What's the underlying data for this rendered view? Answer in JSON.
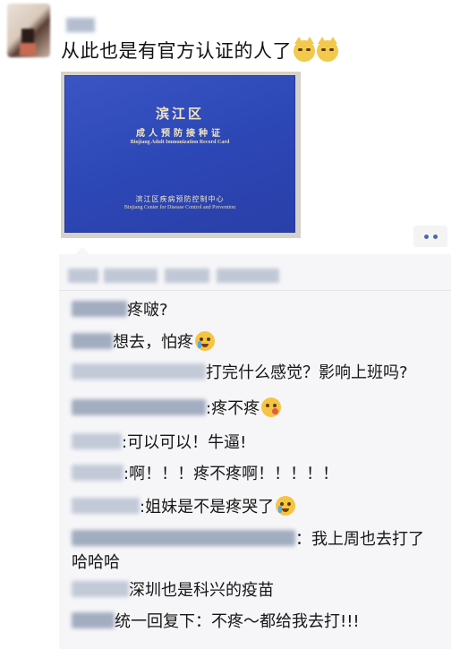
{
  "post": {
    "text": "从此也是有官方认证的人了"
  },
  "photo": {
    "title": "滨江区",
    "subtitle": "成人预防接种证",
    "subtitle_en": "Binjiang Adult Immunization Record Card",
    "issuer": "滨江区疾病预防控制中心",
    "issuer_en": "Binjiang Center for Disease Control and Prevention"
  },
  "comments": [
    {
      "text": "疼啵?",
      "emoji": ""
    },
    {
      "text": "想去，怕疼",
      "emoji": "crying-face"
    },
    {
      "text": "打完什么感觉？影响上班吗?",
      "emoji": ""
    },
    {
      "text": ":疼不疼",
      "emoji": "dizzy-face"
    },
    {
      "text": ":可以可以！牛逼!",
      "emoji": ""
    },
    {
      "text": ":啊！！！疼不疼啊！！！！！",
      "emoji": ""
    },
    {
      "text": ":姐妹是不是疼哭了",
      "emoji": "crying-face"
    },
    {
      "text": "：我上周也去打了",
      "emoji": ""
    },
    {
      "text": "哈哈哈",
      "emoji": ""
    },
    {
      "text": "深圳也是科兴的疫苗",
      "emoji": ""
    },
    {
      "text": "统一回复下：不疼～都给我去打!!!",
      "emoji": ""
    }
  ]
}
